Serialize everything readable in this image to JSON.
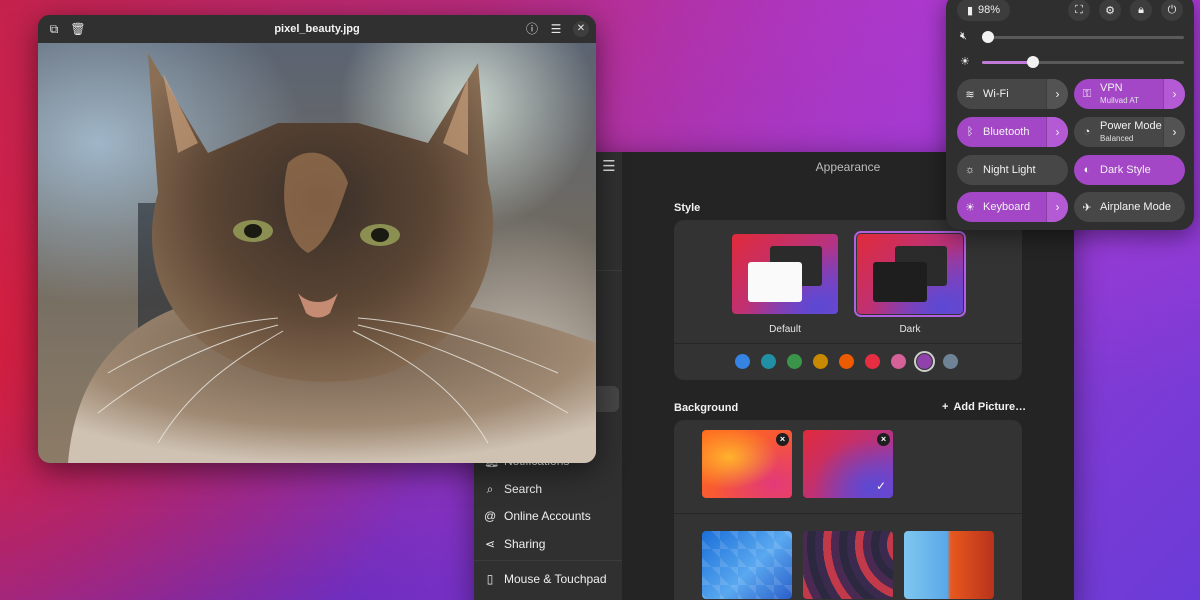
{
  "viewer": {
    "title": "pixel_beauty.jpg",
    "icons": [
      "copy-icon",
      "trash-icon",
      "info-icon",
      "menu-icon",
      "close-icon"
    ]
  },
  "settings": {
    "title": "Appearance",
    "sidebar": [
      {
        "label": "Notifications",
        "icon": "bell-icon"
      },
      {
        "label": "Search",
        "icon": "search-icon"
      },
      {
        "label": "Online Accounts",
        "icon": "at-icon"
      },
      {
        "label": "Sharing",
        "icon": "share-icon"
      },
      {
        "label": "Mouse & Touchpad",
        "icon": "mouse-icon"
      }
    ],
    "style": {
      "label": "Style",
      "options": [
        {
          "label": "Default",
          "selected": false
        },
        {
          "label": "Dark",
          "selected": true
        }
      ],
      "accent_colors": [
        "#3584e4",
        "#2190a4",
        "#3a944a",
        "#c88800",
        "#ed5b00",
        "#e62d42",
        "#d56199",
        "#9141ac",
        "#6f8396"
      ],
      "selected_accent": "#9141ac"
    },
    "background": {
      "label": "Background",
      "add_label": "Add Picture…",
      "wallpapers": [
        "orange-gradient",
        "purple-gradient",
        "blue-triangles",
        "dark-waves",
        "blue-orange-split"
      ],
      "selected": "purple-gradient"
    }
  },
  "quick_settings": {
    "battery": "98%",
    "volume_level": 0.03,
    "brightness_level": 0.25,
    "toggles": [
      {
        "label": "Wi-Fi",
        "sub": "",
        "active": false,
        "has_menu": true,
        "icon": "wifi-off-icon"
      },
      {
        "label": "VPN",
        "sub": "Mullvad AT",
        "active": true,
        "has_menu": true,
        "icon": "vpn-icon"
      },
      {
        "label": "Bluetooth",
        "sub": "",
        "active": true,
        "has_menu": true,
        "icon": "bluetooth-icon"
      },
      {
        "label": "Power Mode",
        "sub": "Balanced",
        "active": false,
        "has_menu": true,
        "icon": "power-mode-icon"
      },
      {
        "label": "Night Light",
        "sub": "",
        "active": false,
        "has_menu": false,
        "icon": "night-light-icon"
      },
      {
        "label": "Dark Style",
        "sub": "",
        "active": true,
        "has_menu": false,
        "icon": "dark-style-icon"
      },
      {
        "label": "Keyboard",
        "sub": "",
        "active": true,
        "has_menu": true,
        "icon": "keyboard-icon"
      },
      {
        "label": "Airplane Mode",
        "sub": "",
        "active": false,
        "has_menu": false,
        "icon": "airplane-icon"
      }
    ]
  }
}
